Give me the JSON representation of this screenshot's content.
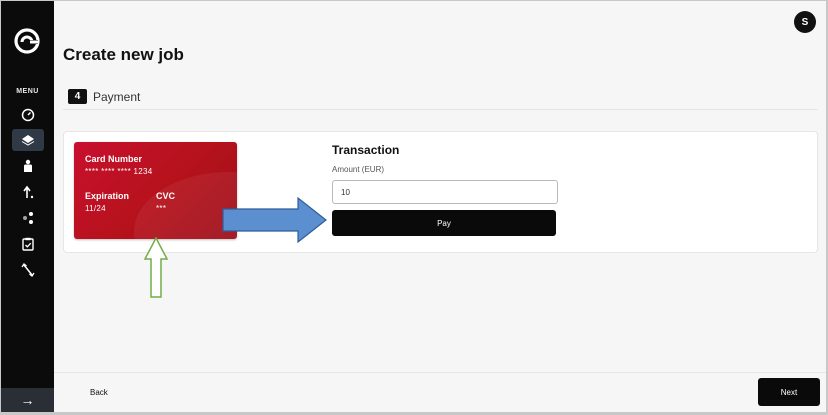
{
  "sidebar": {
    "menu_label": "MENU",
    "footer_arrow": "→",
    "items": [
      {
        "icon": "dashboard-icon"
      },
      {
        "icon": "layers-icon",
        "active": true
      },
      {
        "icon": "person-icon"
      },
      {
        "icon": "arrow-up-icon"
      },
      {
        "icon": "nodes-icon"
      },
      {
        "icon": "clipboard-check-icon"
      },
      {
        "icon": "transfer-icon"
      }
    ]
  },
  "header": {
    "avatar_initial": "S",
    "title": "Create new job"
  },
  "step": {
    "number": "4",
    "label": "Payment"
  },
  "card": {
    "number_label": "Card Number",
    "number_value": "**** **** **** 1234",
    "expiration_label": "Expiration",
    "expiration_value": "11/24",
    "cvc_label": "CVC",
    "cvc_value": "***"
  },
  "transaction": {
    "title": "Transaction",
    "amount_label": "Amount (EUR)",
    "amount_value": "10",
    "pay_label": "Pay"
  },
  "footer": {
    "back_label": "Back",
    "next_label": "Next"
  },
  "colors": {
    "card_red": "#c8102e",
    "sidebar_bg": "#0b0b0b",
    "annotation_blue": "#5b8fd0",
    "annotation_green": "#70ad47"
  }
}
